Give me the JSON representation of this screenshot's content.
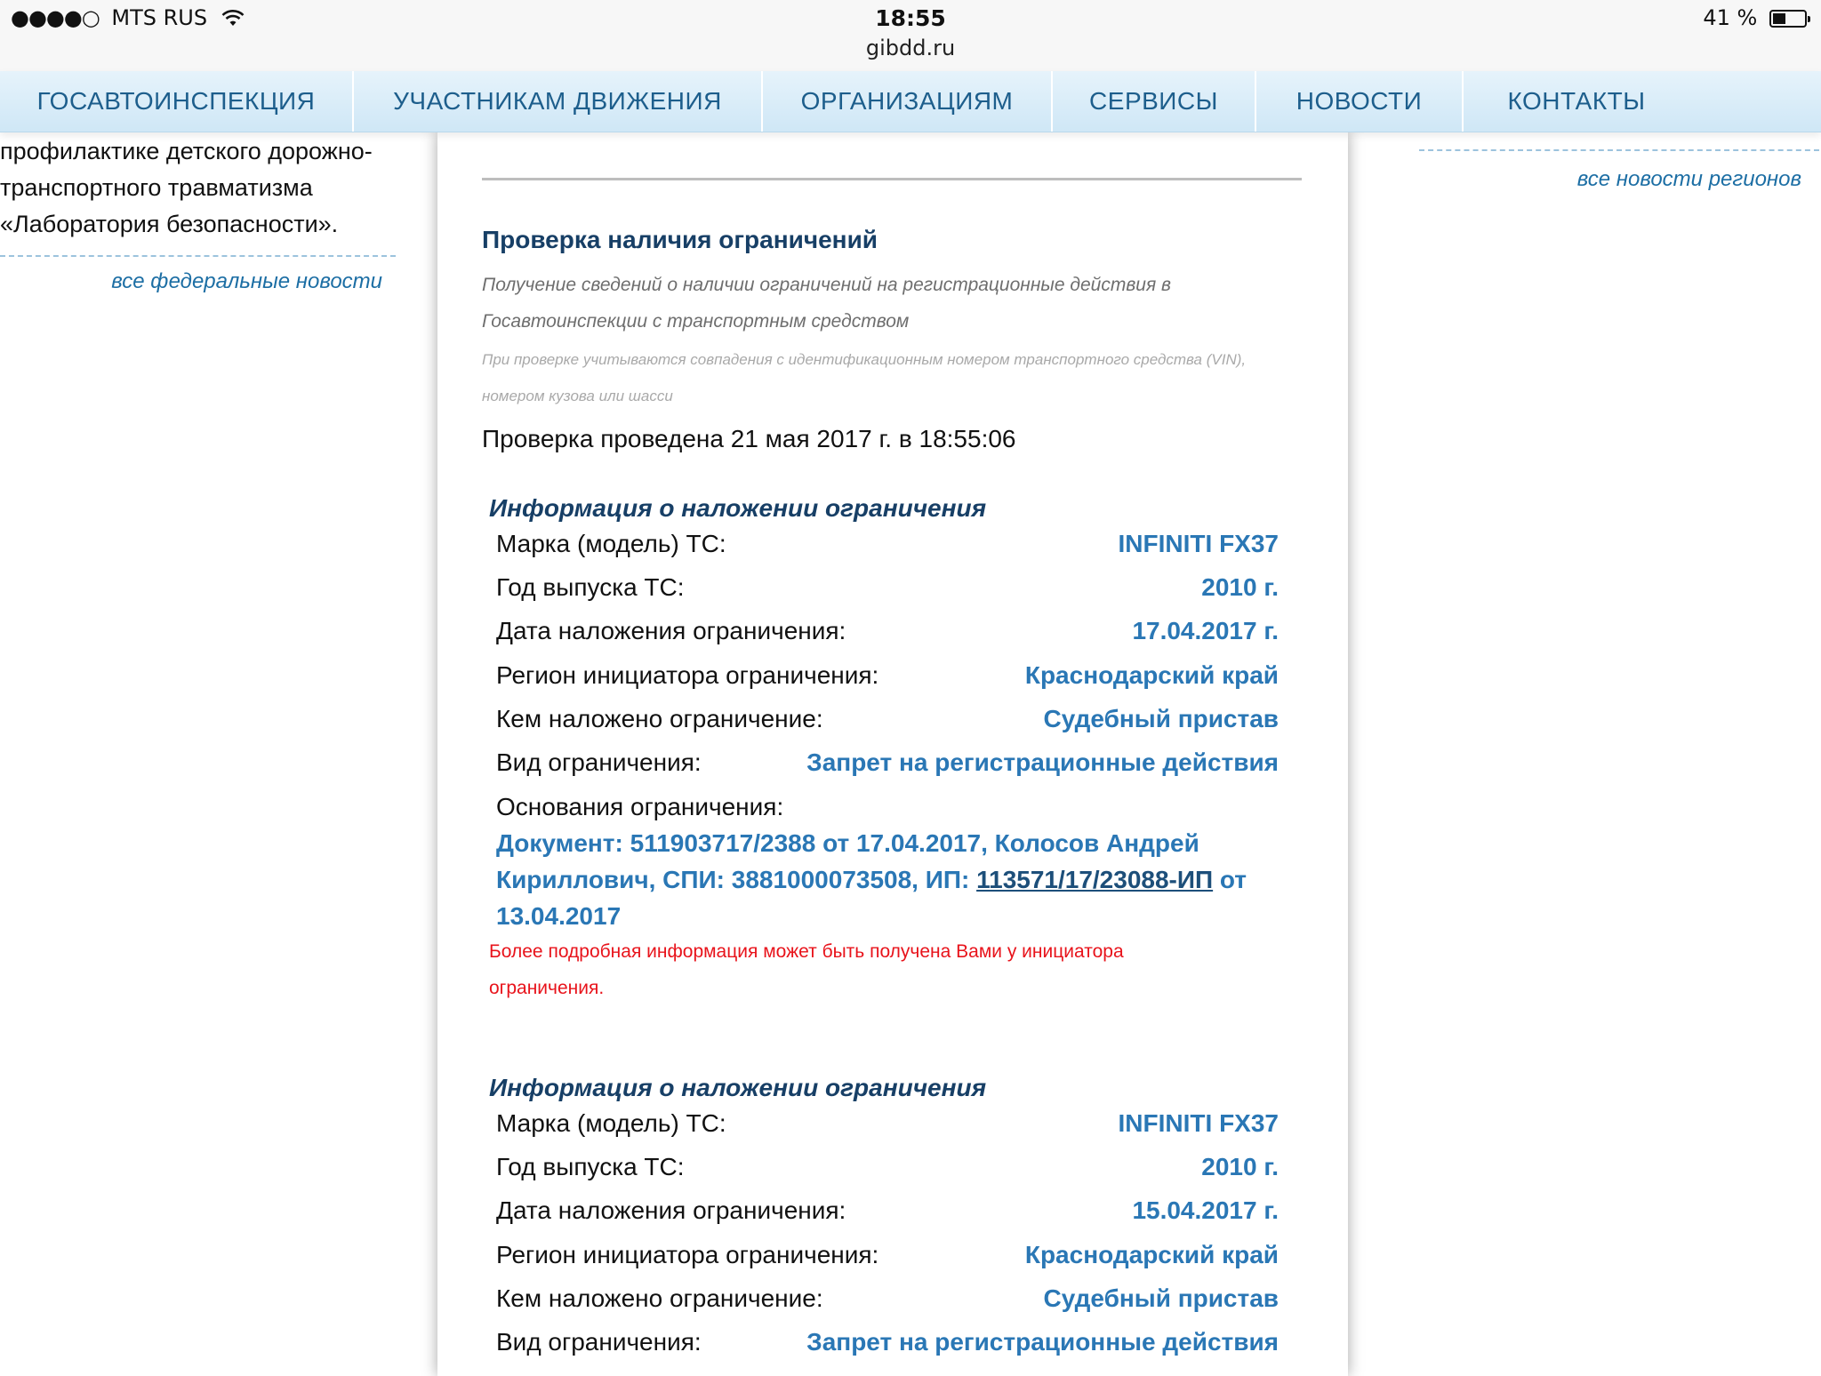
{
  "status_bar": {
    "signal": "●●●●○",
    "carrier": "MTS RUS",
    "time": "18:55",
    "url": "gibdd.ru",
    "battery": "41 %",
    "battery_level": 0.41,
    "wifi_icon": "wifi-icon",
    "battery_icon": "battery-icon"
  },
  "nav": {
    "items": [
      {
        "label": "ГОСАВТОИНСПЕКЦИЯ"
      },
      {
        "label": "УЧАСТНИКАМ ДВИЖЕНИЯ"
      },
      {
        "label": "ОРГАНИЗАЦИЯМ"
      },
      {
        "label": "СЕРВИСЫ"
      },
      {
        "label": "НОВОСТИ"
      },
      {
        "label": "КОНТАКТЫ"
      }
    ]
  },
  "left": {
    "text": "профилактике детского дорожно-транспортного травматизма «Лаборатория безопасности».",
    "link": "все федеральные новости"
  },
  "right": {
    "link": "все новости регионов"
  },
  "check": {
    "title": "Проверка наличия ограничений",
    "description": "Получение сведений о наличии ограничений на регистрационные действия в Госавтоинспекции с транспортным средством",
    "note": "При проверке учитываются совпадения с идентификационным номером транспортного средства (VIN), номером кузова или шасси",
    "date_text": "Проверка проведена 21 мая 2017 г. в 18:55:06"
  },
  "labels": {
    "block_title": "Информация о наложении ограничения",
    "model": "Марка (модель) ТС:",
    "year": "Год выпуска ТС:",
    "date": "Дата наложения ограничения:",
    "region": "Регион инициатора ограничения:",
    "by": "Кем наложено ограничение:",
    "kind": "Вид ограничения:",
    "basis": "Основания ограничения:",
    "more_info": "Более подробная информация может быть получена Вами у инициатора ограничения."
  },
  "restrictions": [
    {
      "model": "INFINITI FX37",
      "year": "2010 г.",
      "date": "17.04.2017 г.",
      "region": "Краснодарский край",
      "by": "Судебный пристав",
      "kind": "Запрет на регистрационные действия",
      "basis_prefix": "Документ: 511903717/2388 от 17.04.2017, Колосов Андрей Кириллович, СПИ: 3881000073508, ИП: ",
      "basis_link": "113571/17/23088-ИП",
      "basis_suffix": " от 13.04.2017"
    },
    {
      "model": "INFINITI FX37",
      "year": "2010 г.",
      "date": "15.04.2017 г.",
      "region": "Краснодарский край",
      "by": "Судебный пристав",
      "kind": "Запрет на регистрационные действия"
    }
  ]
}
